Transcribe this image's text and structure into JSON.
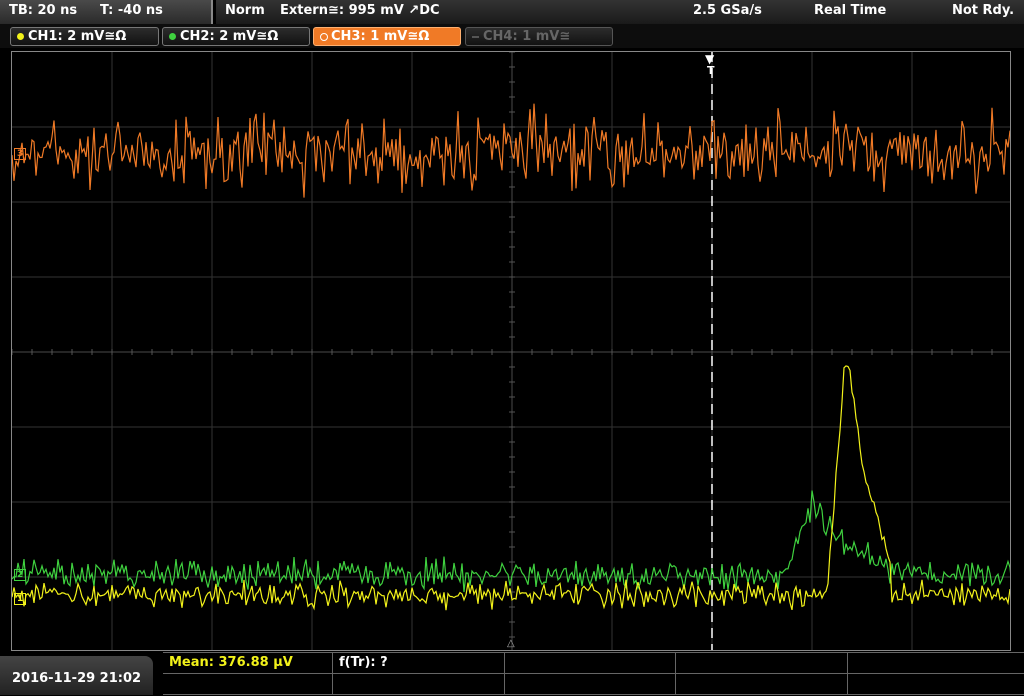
{
  "header": {
    "timebase": "TB: 20 ns",
    "trigger_time": "T: -40 ns",
    "mode": "Norm",
    "trigger_source": "Extern≅: 995 mV ↗DC",
    "sample_rate": "2.5 GSa/s",
    "acq_mode": "Real Time",
    "status": "Not Rdy."
  },
  "channels": [
    {
      "label": "CH1: 2 mV≅Ω",
      "color": "#f2f21a",
      "state": "on"
    },
    {
      "label": "CH2: 2 mV≅Ω",
      "color": "#3fd13f",
      "state": "on"
    },
    {
      "label": "CH3: 1 mV≅Ω",
      "color": "#f07a26",
      "state": "active"
    },
    {
      "label": "CH4: 1 mV≅",
      "color": "#666666",
      "state": "off"
    }
  ],
  "trigger_marker": "T",
  "markers": {
    "ch3": "3",
    "ch2": "2",
    "ch1": "1"
  },
  "measurements": {
    "mean": "Mean: 376.88 µV",
    "ftr": "f(Tr): ?"
  },
  "footer": {
    "datetime": "2016-11-29 21:02"
  },
  "colors": {
    "ch1": "#f2f21a",
    "ch2": "#3fd13f",
    "ch3": "#f07a26",
    "grid": "#3a3a3a"
  }
}
